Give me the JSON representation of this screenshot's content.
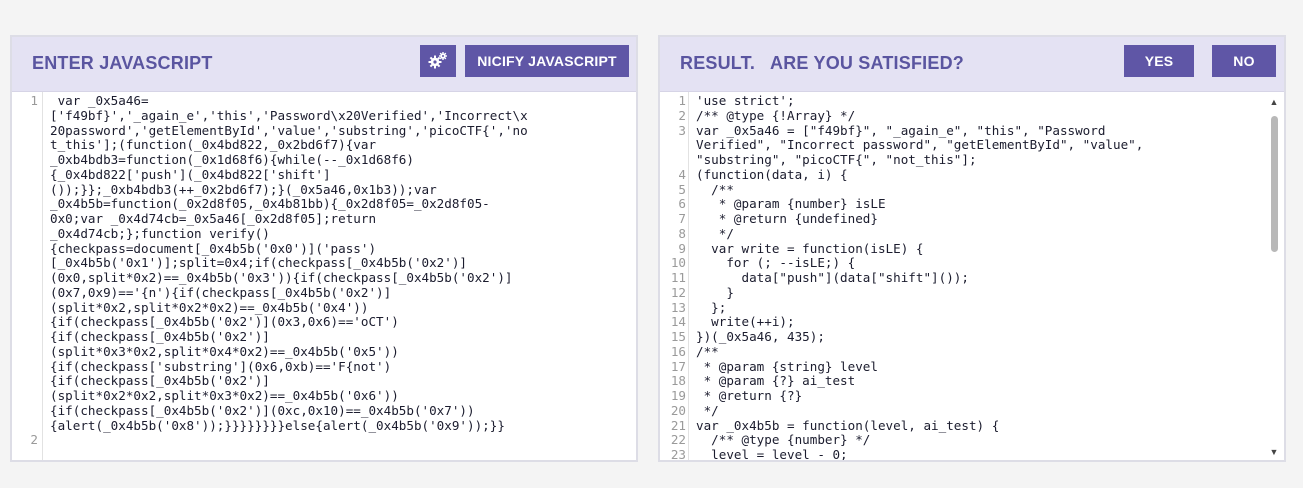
{
  "left_panel": {
    "title": "ENTER JAVASCRIPT",
    "settings_icon": "gears-icon",
    "nicify_label": "NICIFY JAVASCRIPT",
    "lines": [
      {
        "n": "1",
        "t": " var _0x5a46="
      },
      {
        "n": "",
        "t": "['f49bf}','_again_e','this','Password\\x20Verified','Incorrect\\x"
      },
      {
        "n": "",
        "t": "20password','getElementById','value','substring','picoCTF{','no"
      },
      {
        "n": "",
        "t": "t_this'];(function(_0x4bd822,_0x2bd6f7){var"
      },
      {
        "n": "",
        "t": "_0xb4bdb3=function(_0x1d68f6){while(--_0x1d68f6)"
      },
      {
        "n": "",
        "t": "{_0x4bd822['push'](_0x4bd822['shift']"
      },
      {
        "n": "",
        "t": "());}};_0xb4bdb3(++_0x2bd6f7);}(_0x5a46,0x1b3));var"
      },
      {
        "n": "",
        "t": "_0x4b5b=function(_0x2d8f05,_0x4b81bb){_0x2d8f05=_0x2d8f05-"
      },
      {
        "n": "",
        "t": "0x0;var _0x4d74cb=_0x5a46[_0x2d8f05];return"
      },
      {
        "n": "",
        "t": "_0x4d74cb;};function verify()"
      },
      {
        "n": "",
        "t": "{checkpass=document[_0x4b5b('0x0')]('pass')"
      },
      {
        "n": "",
        "t": "[_0x4b5b('0x1')];split=0x4;if(checkpass[_0x4b5b('0x2')]"
      },
      {
        "n": "",
        "t": "(0x0,split*0x2)==_0x4b5b('0x3')){if(checkpass[_0x4b5b('0x2')]"
      },
      {
        "n": "",
        "t": "(0x7,0x9)=='{n'){if(checkpass[_0x4b5b('0x2')]"
      },
      {
        "n": "",
        "t": "(split*0x2,split*0x2*0x2)==_0x4b5b('0x4'))"
      },
      {
        "n": "",
        "t": "{if(checkpass[_0x4b5b('0x2')](0x3,0x6)=='oCT')"
      },
      {
        "n": "",
        "t": "{if(checkpass[_0x4b5b('0x2')]"
      },
      {
        "n": "",
        "t": "(split*0x3*0x2,split*0x4*0x2)==_0x4b5b('0x5'))"
      },
      {
        "n": "",
        "t": "{if(checkpass['substring'](0x6,0xb)=='F{not')"
      },
      {
        "n": "",
        "t": "{if(checkpass[_0x4b5b('0x2')]"
      },
      {
        "n": "",
        "t": "(split*0x2*0x2,split*0x3*0x2)==_0x4b5b('0x6'))"
      },
      {
        "n": "",
        "t": "{if(checkpass[_0x4b5b('0x2')](0xc,0x10)==_0x4b5b('0x7'))"
      },
      {
        "n": "",
        "t": "{alert(_0x4b5b('0x8'));}}}}}}}}else{alert(_0x4b5b('0x9'));}}"
      },
      {
        "n": "2",
        "t": ""
      }
    ]
  },
  "right_panel": {
    "title": "RESULT.   ARE YOU SATISFIED?",
    "yes_label": "YES",
    "no_label": "NO",
    "lines": [
      {
        "n": "1",
        "t": "'use strict';"
      },
      {
        "n": "2",
        "t": "/** @type {!Array} */"
      },
      {
        "n": "3",
        "t": "var _0x5a46 = [\"f49bf}\", \"_again_e\", \"this\", \"Password"
      },
      {
        "n": "",
        "t": "Verified\", \"Incorrect password\", \"getElementById\", \"value\","
      },
      {
        "n": "",
        "t": "\"substring\", \"picoCTF{\", \"not_this\"];"
      },
      {
        "n": "4",
        "t": "(function(data, i) {"
      },
      {
        "n": "5",
        "t": "  /**"
      },
      {
        "n": "6",
        "t": "   * @param {number} isLE"
      },
      {
        "n": "7",
        "t": "   * @return {undefined}"
      },
      {
        "n": "8",
        "t": "   */"
      },
      {
        "n": "9",
        "t": "  var write = function(isLE) {"
      },
      {
        "n": "10",
        "t": "    for (; --isLE;) {"
      },
      {
        "n": "11",
        "t": "      data[\"push\"](data[\"shift\"]());"
      },
      {
        "n": "12",
        "t": "    }"
      },
      {
        "n": "13",
        "t": "  };"
      },
      {
        "n": "14",
        "t": "  write(++i);"
      },
      {
        "n": "15",
        "t": "})(_0x5a46, 435);"
      },
      {
        "n": "16",
        "t": "/**"
      },
      {
        "n": "17",
        "t": " * @param {string} level"
      },
      {
        "n": "18",
        "t": " * @param {?} ai_test"
      },
      {
        "n": "19",
        "t": " * @return {?}"
      },
      {
        "n": "20",
        "t": " */"
      },
      {
        "n": "21",
        "t": "var _0x4b5b = function(level, ai_test) {"
      },
      {
        "n": "22",
        "t": "  /** @type {number} */"
      },
      {
        "n": "23",
        "t": "  level = level - 0;"
      }
    ]
  }
}
